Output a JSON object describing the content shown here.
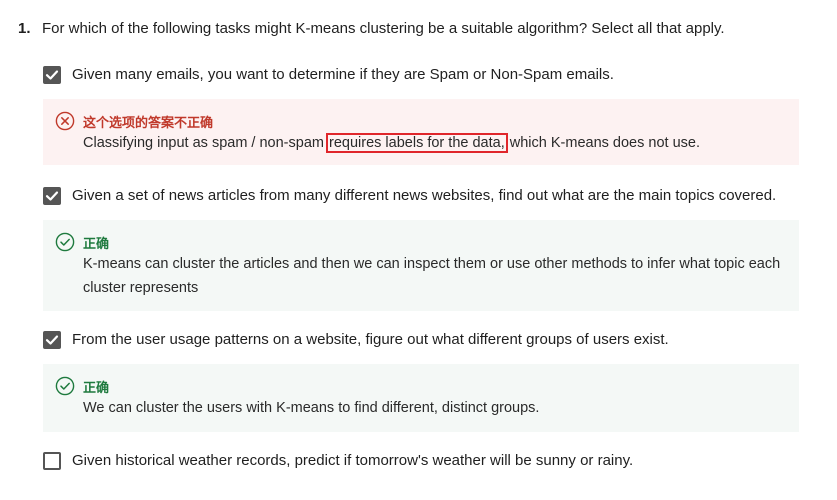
{
  "question": {
    "number": "1.",
    "text": "For which of the following tasks might K-means clustering be a suitable algorithm? Select all that apply."
  },
  "options": [
    {
      "text": "Given many emails, you want to determine if they are Spam or Non-Spam emails.",
      "checked": true,
      "feedback": {
        "status": "wrong",
        "title": "这个选项的答案不正确",
        "text_before": "Classifying input as spam / non-spam",
        "text_highlight": "requires labels for the data,",
        "text_after": "which K-means does not use."
      }
    },
    {
      "text": "Given a set of news articles from many different news websites, find out what are the main topics covered.",
      "checked": true,
      "feedback": {
        "status": "right",
        "title": "正确",
        "text": "K-means can cluster the articles and then we can inspect them or use other methods to infer what topic each cluster represents"
      }
    },
    {
      "text": "From the user usage patterns on a website, figure out what different groups of users exist.",
      "checked": true,
      "feedback": {
        "status": "right",
        "title": "正确",
        "text": "We can cluster the users with K-means to find different, distinct groups."
      }
    },
    {
      "text": "Given historical weather records, predict if tomorrow's weather will be sunny or rainy.",
      "checked": false
    }
  ],
  "colors": {
    "checkbox": "#555555",
    "wrong": "#c0392b",
    "wrong_bg": "#fdf2f2",
    "right": "#1e7a3e",
    "right_bg": "#f4f8f6",
    "highlight_box": "#e0262b"
  },
  "icons": {
    "checkbox_checked": "check-icon",
    "feedback_wrong": "x-circle-icon",
    "feedback_right": "check-circle-icon"
  }
}
